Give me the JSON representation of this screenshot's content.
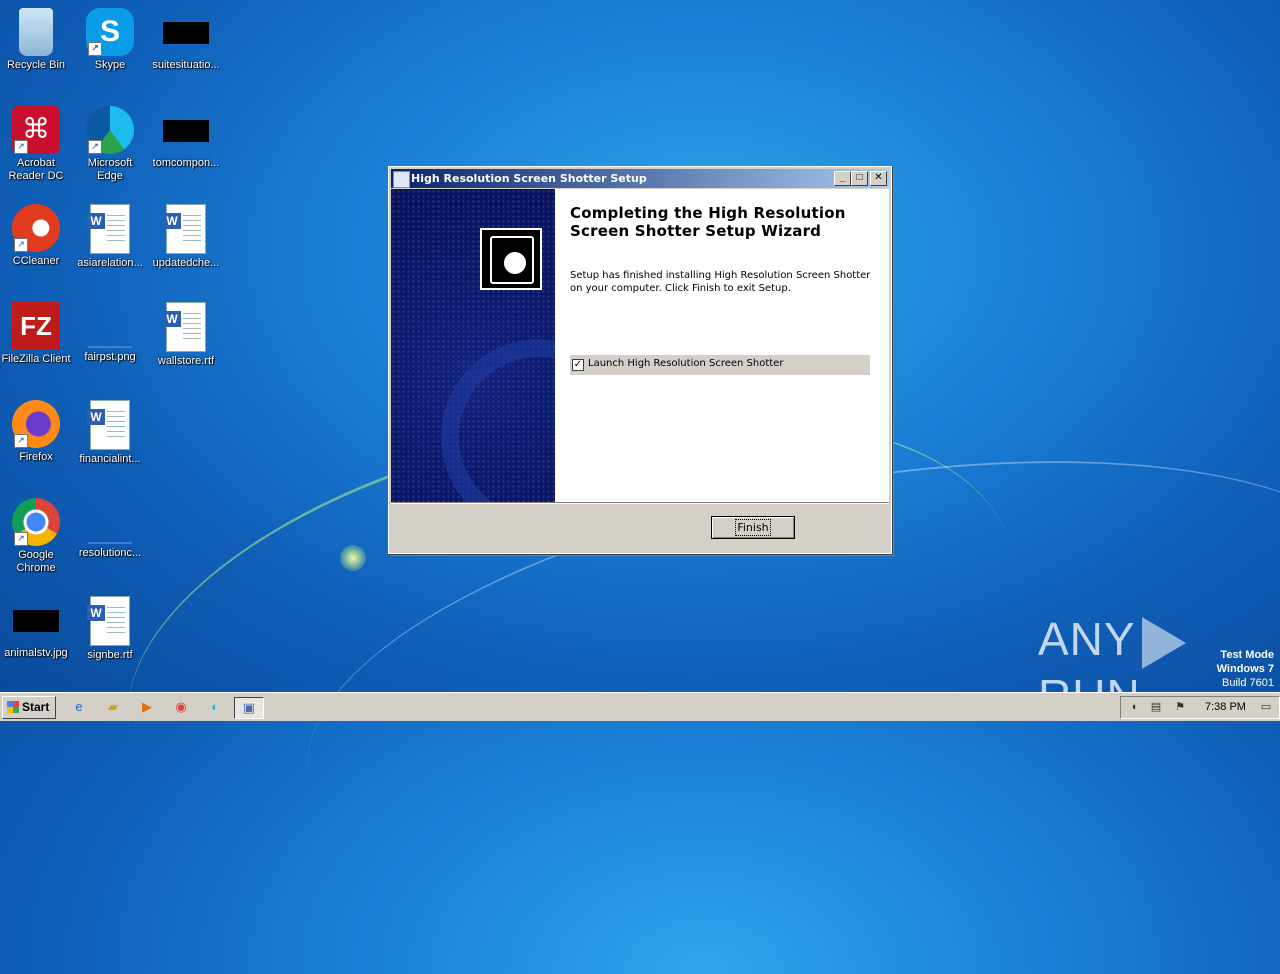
{
  "desktop": {
    "icons": [
      {
        "label": "Recycle Bin"
      },
      {
        "label": "Skype"
      },
      {
        "label": "suitesituatio..."
      },
      {
        "label": "Acrobat Reader DC"
      },
      {
        "label": "Microsoft Edge"
      },
      {
        "label": "tomcompon..."
      },
      {
        "label": "CCleaner"
      },
      {
        "label": "asiarelation..."
      },
      {
        "label": "updatedche..."
      },
      {
        "label": "FileZilla Client"
      },
      {
        "label": "fairpst.png"
      },
      {
        "label": "wallstore.rtf"
      },
      {
        "label": "Firefox"
      },
      {
        "label": "financialint..."
      },
      {
        "label": "Google Chrome"
      },
      {
        "label": "resolutionc..."
      },
      {
        "label": "animalstv.jpg"
      },
      {
        "label": "signbe.rtf"
      }
    ]
  },
  "dialog": {
    "title": "High Resolution Screen Shotter Setup",
    "heading": "Completing the High Resolution Screen Shotter Setup Wizard",
    "body": "Setup has finished installing High Resolution Screen Shotter on your computer. Click Finish to exit Setup.",
    "checkbox_label": "Launch High Resolution Screen Shotter",
    "checkbox_checked": true,
    "finish_label": "Finish",
    "minimize_glyph": "_",
    "maximize_glyph": "□",
    "close_glyph": "✕"
  },
  "watermark": {
    "brand_left": "ANY",
    "brand_right": "RUN",
    "mode_line1": "Test Mode",
    "mode_line2": "Windows 7",
    "mode_line3": "Build 7601"
  },
  "taskbar": {
    "start_label": "Start",
    "clock": "7:38 PM"
  }
}
